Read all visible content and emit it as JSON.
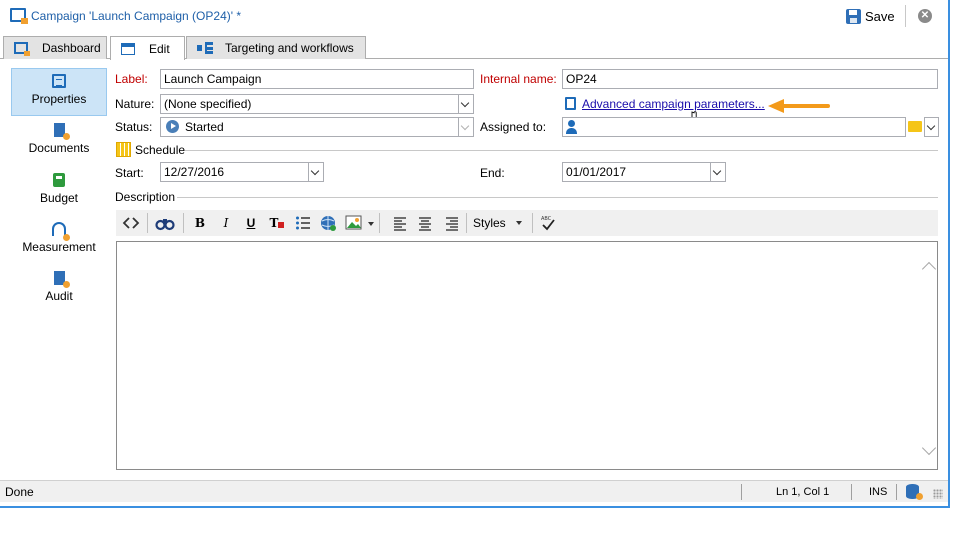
{
  "window": {
    "title": "Campaign 'Launch Campaign (OP24)' *",
    "save_label": "Save",
    "close_glyph": "✕"
  },
  "tabs": [
    {
      "label": "Dashboard",
      "icon": "dashboard-icon"
    },
    {
      "label": "Edit",
      "icon": "edit-icon",
      "active": true
    },
    {
      "label": "Targeting and workflows",
      "icon": "workflow-icon"
    }
  ],
  "sidebar": {
    "items": [
      {
        "label": "Properties",
        "icon": "properties-icon",
        "active": true
      },
      {
        "label": "Documents",
        "icon": "documents-icon"
      },
      {
        "label": "Budget",
        "icon": "budget-icon"
      },
      {
        "label": "Measurement",
        "icon": "measurement-icon"
      },
      {
        "label": "Audit",
        "icon": "audit-icon"
      }
    ]
  },
  "form": {
    "label_caption": "Label:",
    "label_value": "Launch Campaign",
    "internal_name_caption": "Internal name:",
    "internal_name_value": "OP24",
    "nature_caption": "Nature:",
    "nature_value": "(None specified)",
    "advanced_link": "Advanced campaign parameters...",
    "status_caption": "Status:",
    "status_value": "Started",
    "assigned_caption": "Assigned to:",
    "assigned_value": "",
    "schedule_heading": "Schedule",
    "start_caption": "Start:",
    "start_value": "12/27/2016",
    "end_caption": "End:",
    "end_value": "01/01/2017",
    "description_heading": "Description"
  },
  "toolbar": {
    "styles_label": "Styles",
    "bold": "B",
    "italic": "I",
    "underline": "U",
    "text_color": "T",
    "source_icon": "source-code-icon",
    "find_icon": "binoculars-icon",
    "spell_icon": "spellcheck-icon",
    "list_icon": "bullet-list-icon",
    "link_icon": "globe-link-icon",
    "image_icon": "image-icon",
    "align_left_icon": "align-left-icon",
    "align_center_icon": "align-center-icon",
    "align_right_icon": "align-right-icon"
  },
  "statusbar": {
    "status": "Done",
    "position": "Ln 1, Col 1",
    "mode": "INS"
  },
  "colors": {
    "accent": "#1e6bb8",
    "required_label": "#c00000",
    "link": "#1a0dab",
    "annotation_arrow": "#f39a1a",
    "sidebar_selected": "#cce4f7"
  }
}
